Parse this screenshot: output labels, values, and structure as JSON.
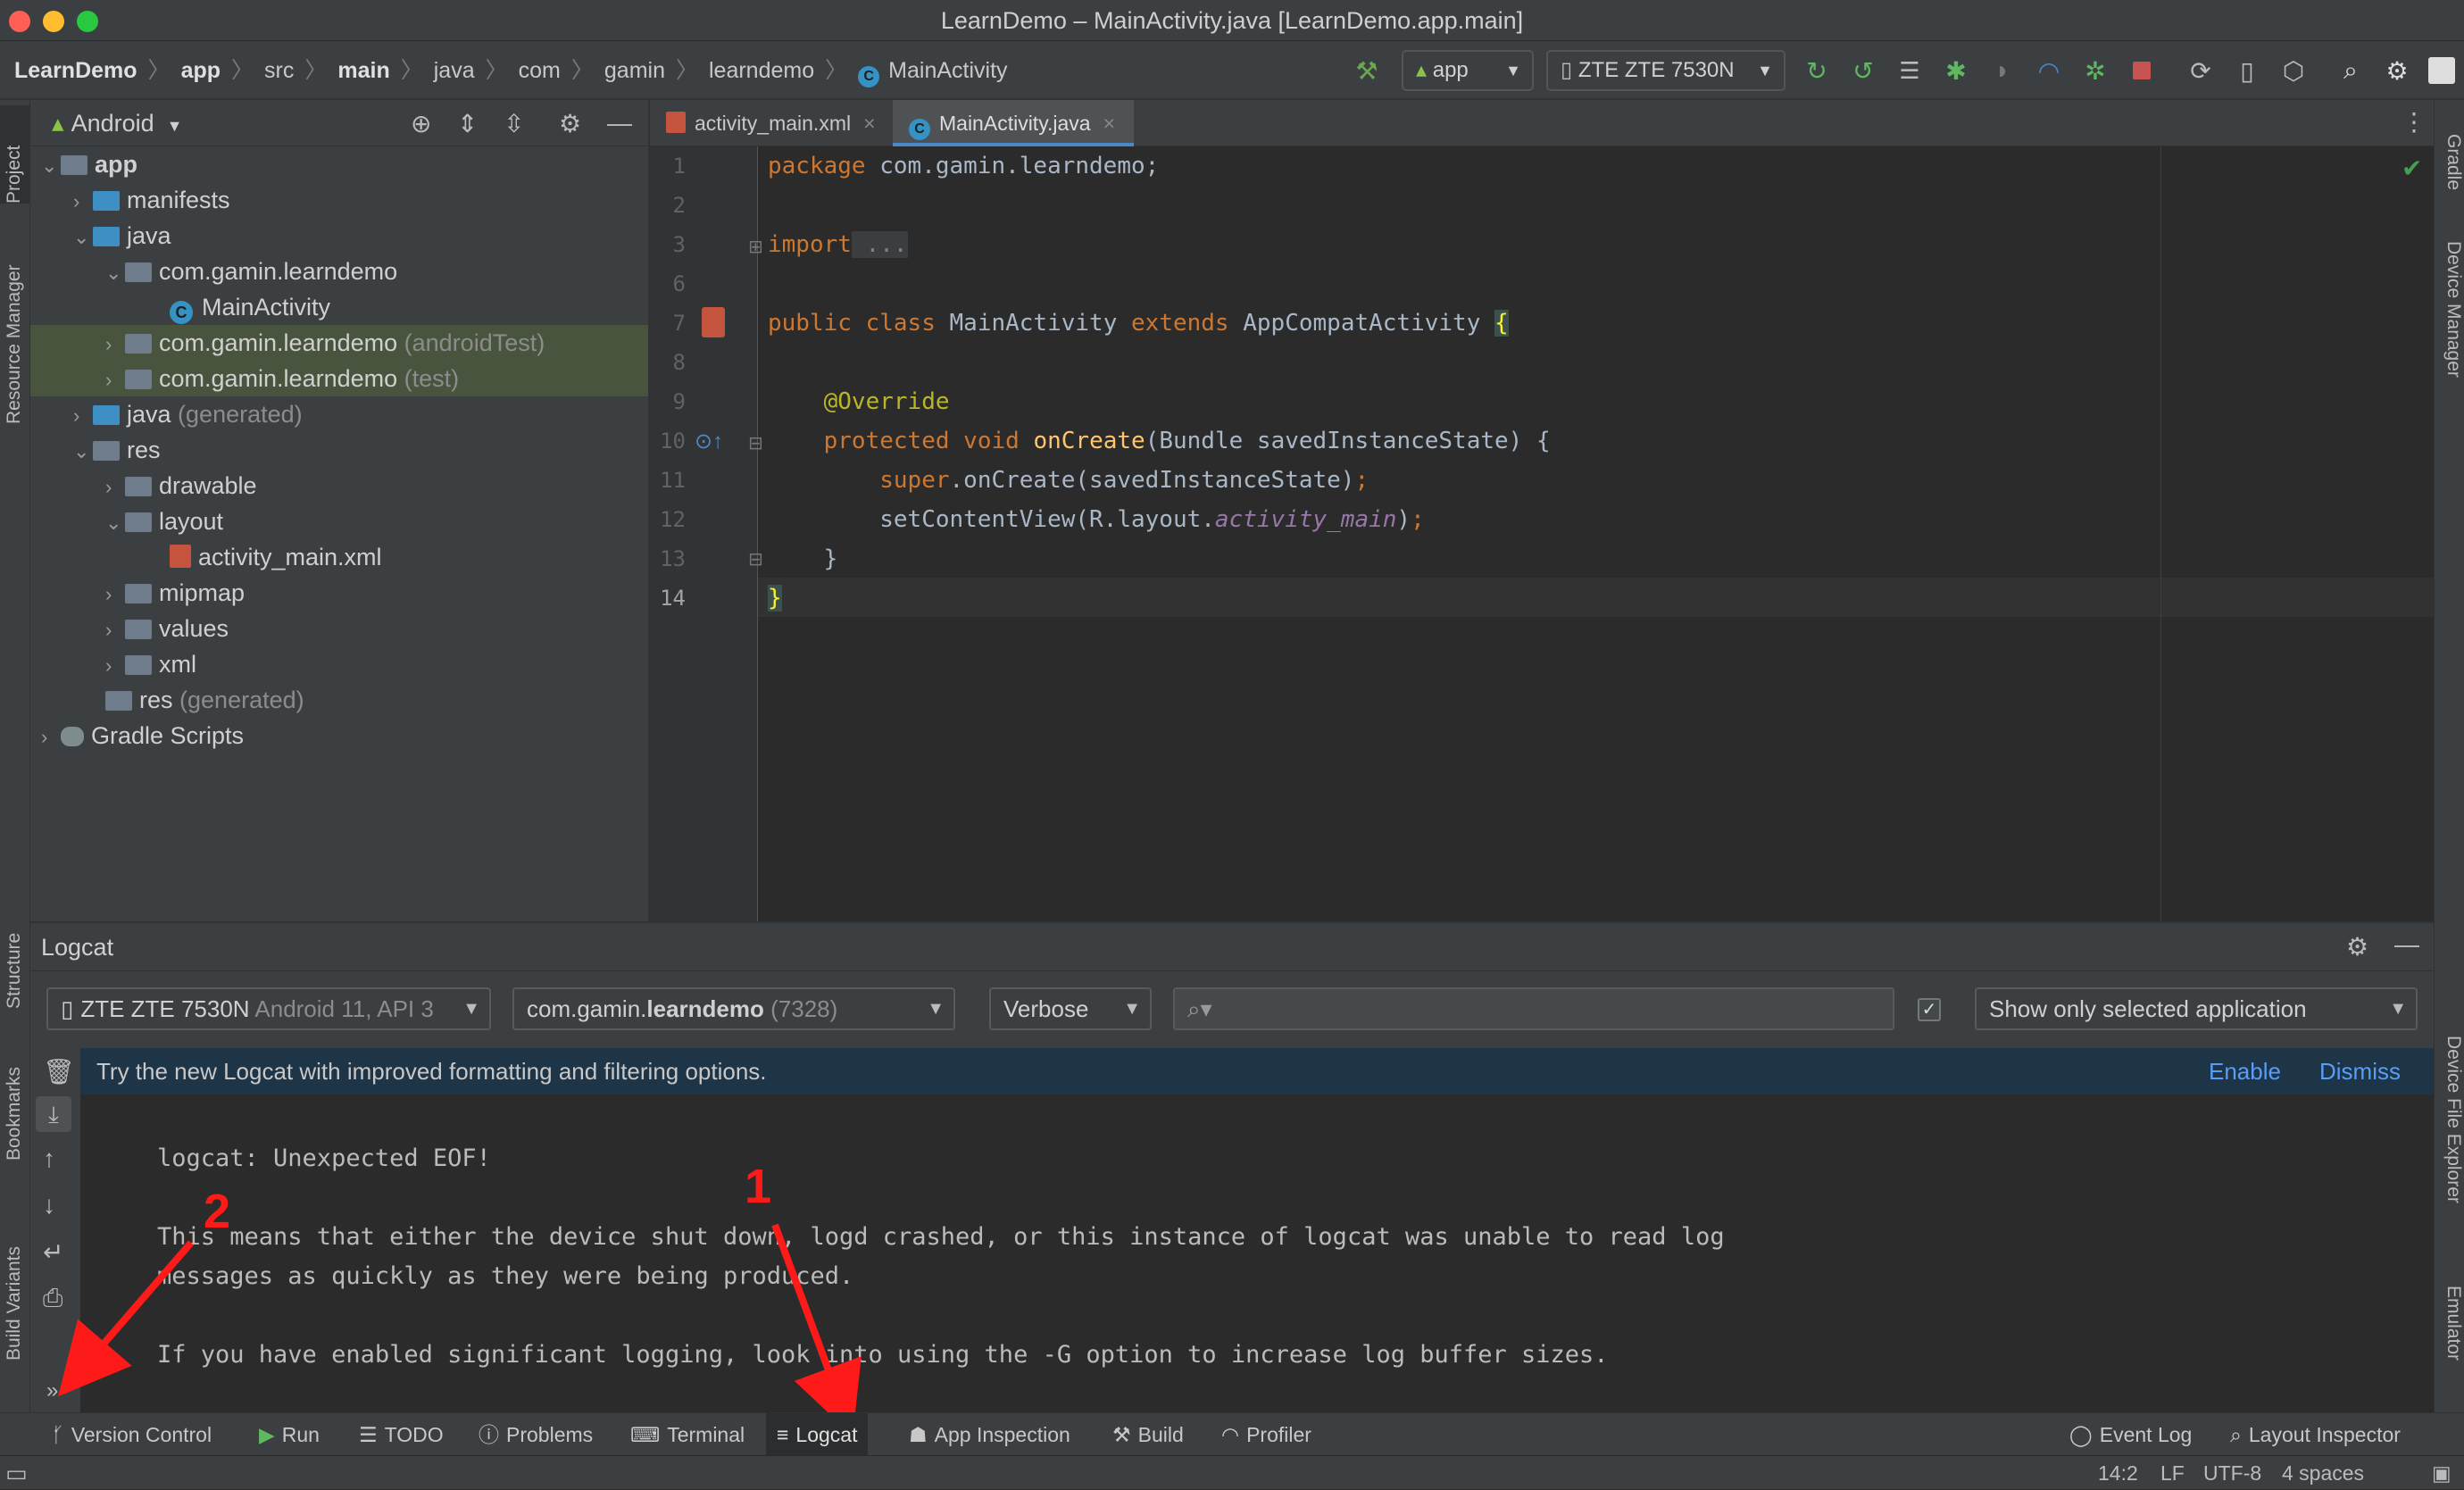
{
  "window": {
    "title": "LearnDemo – MainActivity.java [LearnDemo.app.main]"
  },
  "breadcrumb": [
    "LearnDemo",
    "app",
    "src",
    "main",
    "java",
    "com",
    "gamin",
    "learndemo",
    "MainActivity"
  ],
  "toolbar": {
    "run_config": "app",
    "device": "ZTE ZTE 7530N"
  },
  "left_strip": {
    "project": "Project",
    "resource_manager": "Resource Manager",
    "structure": "Structure",
    "bookmarks": "Bookmarks",
    "build_variants": "Build Variants"
  },
  "right_strip": {
    "gradle": "Gradle",
    "device_manager": "Device Manager",
    "device_file_explorer": "Device File Explorer",
    "emulator": "Emulator"
  },
  "project": {
    "view_mode": "Android",
    "tree": [
      {
        "label": "app",
        "dim": ""
      },
      {
        "label": "manifests",
        "dim": ""
      },
      {
        "label": "java",
        "dim": ""
      },
      {
        "label": "com.gamin.learndemo",
        "dim": ""
      },
      {
        "label": "MainActivity",
        "dim": ""
      },
      {
        "label": "com.gamin.learndemo",
        "dim": "(androidTest)"
      },
      {
        "label": "com.gamin.learndemo",
        "dim": "(test)"
      },
      {
        "label": "java",
        "dim": "(generated)"
      },
      {
        "label": "res",
        "dim": ""
      },
      {
        "label": "drawable",
        "dim": ""
      },
      {
        "label": "layout",
        "dim": ""
      },
      {
        "label": "activity_main.xml",
        "dim": ""
      },
      {
        "label": "mipmap",
        "dim": ""
      },
      {
        "label": "values",
        "dim": ""
      },
      {
        "label": "xml",
        "dim": ""
      },
      {
        "label": "res",
        "dim": "(generated)"
      },
      {
        "label": "Gradle Scripts",
        "dim": ""
      }
    ]
  },
  "editor": {
    "tabs": [
      "activity_main.xml",
      "MainActivity.java"
    ],
    "line_numbers": [
      "1",
      "2",
      "3",
      "6",
      "7",
      "8",
      "9",
      "10",
      "11",
      "12",
      "13",
      "14"
    ],
    "code": {
      "l1_kw": "package",
      "l1_rest": " com.gamin.learndemo;",
      "l3_kw": "import",
      "l3_rest": " ...",
      "l7_kw1": "public",
      "l7_kw2": "class",
      "l7_name": " MainActivity ",
      "l7_kw3": "extends",
      "l7_rest": " AppCompatActivity ",
      "l7_brace": "{",
      "l9_an": "@Override",
      "l10_kw1": "protected",
      "l10_kw2": "void",
      "l10_fn": "onCreate",
      "l10_rest": "(Bundle savedInstanceState) {",
      "l11_kw": "super",
      "l11_rest": ".onCreate(savedInstanceState)",
      "l11_semi": ";",
      "l12_a": "setContentView(R.layout.",
      "l12_it": "activity_main",
      "l12_b": ")",
      "l12_semi": ";",
      "l13": "}",
      "l14": "}"
    }
  },
  "logcat": {
    "title": "Logcat",
    "device": "ZTE ZTE 7530N",
    "device_dim": "Android 11, API 3",
    "process": "com.gamin.",
    "process_bold": "learndemo",
    "process_pid": "(7328)",
    "level": "Verbose",
    "search_placeholder": "",
    "filter": "Show only selected application",
    "banner_text": "Try the new Logcat with improved formatting and filtering options.",
    "banner_enable": "Enable",
    "banner_dismiss": "Dismiss",
    "lines": [
      "logcat: Unexpected EOF!",
      "This means that either the device shut down, logd crashed, or this instance of logcat was unable to read log",
      "messages as quickly as they were being produced.",
      "If you have enabled significant logging, look into using the -G option to increase log buffer sizes."
    ],
    "annotation_1": "1",
    "annotation_2": "2"
  },
  "bottom_tabs": [
    "Version Control",
    "Run",
    "TODO",
    "Problems",
    "Terminal",
    "Logcat",
    "App Inspection",
    "Build",
    "Profiler",
    "Event Log",
    "Layout Inspector"
  ],
  "status": {
    "position": "14:2",
    "line_sep": "LF",
    "encoding": "UTF-8",
    "indent": "4 spaces"
  },
  "colors": {
    "accent": "#4a88c7",
    "annotation": "#ff1a1a",
    "bg": "#2b2b2b",
    "panel": "#3c3f41"
  }
}
